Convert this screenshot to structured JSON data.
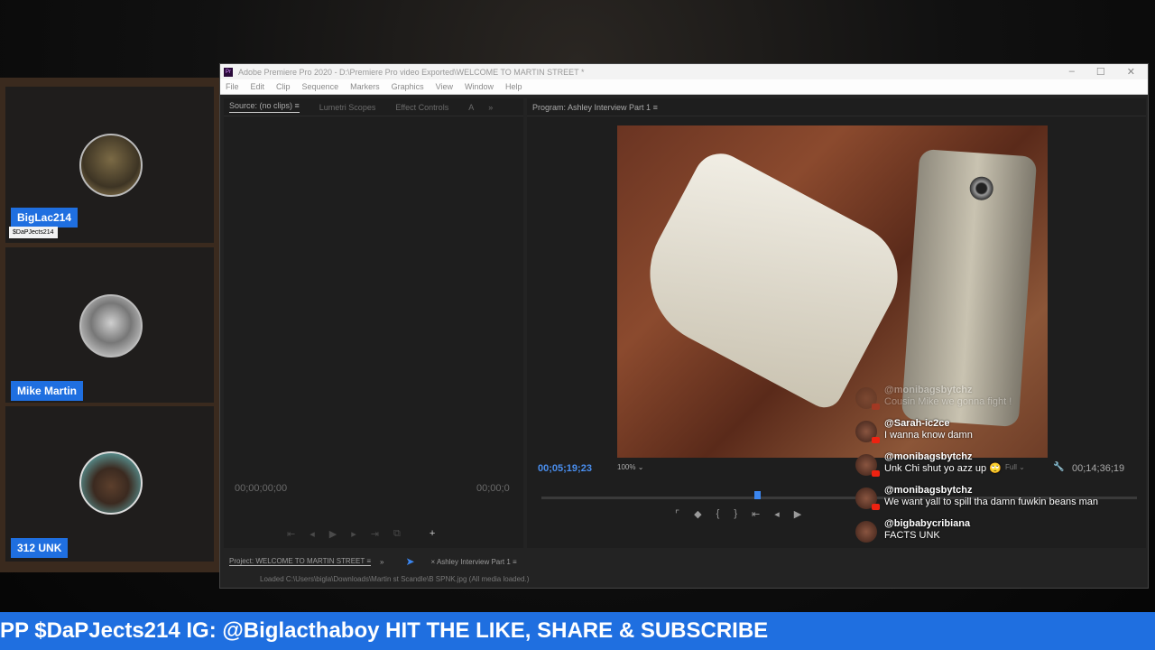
{
  "participants": [
    {
      "name": "BigLac214",
      "tag": "$DaPJects214"
    },
    {
      "name": "Mike Martin"
    },
    {
      "name": "312 UNK"
    }
  ],
  "premiere": {
    "title": "Adobe Premiere Pro 2020 - D:\\Premiere Pro video Exported\\WELCOME TO MARTIN STREET *",
    "menu": [
      "File",
      "Edit",
      "Clip",
      "Sequence",
      "Markers",
      "Graphics",
      "View",
      "Window",
      "Help"
    ],
    "source_tabs": [
      "Source: (no clips)",
      "Lumetri Scopes",
      "Effect Controls",
      "A"
    ],
    "program_tab": "Program: Ashley Interview Part 1",
    "source_tc_left": "00;00;00;00",
    "source_tc_right": "00;00;0",
    "program_tc_left": "00;05;19;23",
    "program_tc_right": "00;14;36;19",
    "zoom": "100%",
    "quality": "Full",
    "project_tab": "Project: WELCOME TO MARTIN STREET",
    "sequence_tab": "Ashley Interview Part 1",
    "status": "Loaded C:\\Users\\bigla\\Downloads\\Martin st Scandle\\B SPNK.jpg (All media loaded.)"
  },
  "chat": [
    {
      "user": "@monibagsbytchz",
      "text": "Cousin Mike we gonna fight !",
      "faded": true
    },
    {
      "user": "@Sarah-ic2ce",
      "text": "I wanna know damn"
    },
    {
      "user": "@monibagsbytchz",
      "text": "Unk Chi shut yo azz up 🙄"
    },
    {
      "user": "@monibagsbytchz",
      "text": "We want yall to spill tha damn fuwkin beans man"
    },
    {
      "user": "@bigbabycribiana",
      "text": "FACTS UNK"
    }
  ],
  "ticker": "PP $DaPJects214 IG: @Biglacthaboy HIT THE LIKE, SHARE & SUBSCRIBE",
  "colors": {
    "accent": "#1f6fe0",
    "timecode": "#4a8ff0"
  }
}
